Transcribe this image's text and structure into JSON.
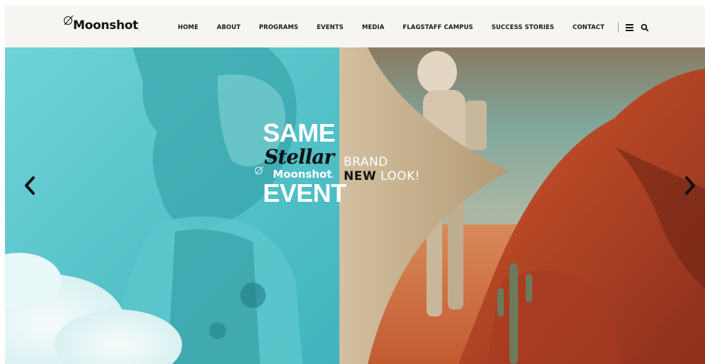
{
  "brand": {
    "name": "Moonshot",
    "dot": "."
  },
  "nav": {
    "items": [
      "HOME",
      "ABOUT",
      "PROGRAMS",
      "EVENTS",
      "MEDIA",
      "FLAGSTAFF CAMPUS",
      "SUCCESS STORIES",
      "CONTACT"
    ],
    "menu_icon": "hamburger-menu-icon",
    "search_icon": "search-icon"
  },
  "hero": {
    "same": "SAME",
    "stellar": "Stellar",
    "logo_text": "Moonshot",
    "logo_dot": ".",
    "event": "EVENT",
    "brand_word": "BRAND",
    "new_word": "NEW",
    "look_word": "LOOK!",
    "prev_icon": "chevron-left-icon",
    "next_icon": "chevron-right-icon"
  },
  "colors": {
    "header_bg": "#f6f5f2",
    "teal": "#4fc3c9",
    "tan": "#c2ad8c",
    "mars_orange": "#c8512a",
    "sky": "#7fa8a0"
  }
}
